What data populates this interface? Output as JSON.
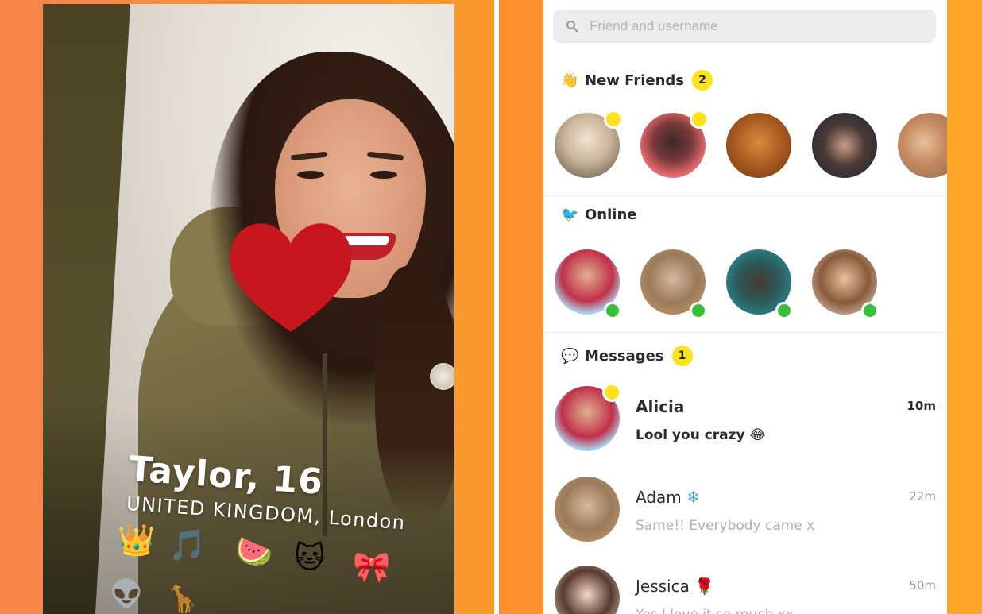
{
  "left_panel": {
    "profile": {
      "name_age": "Taylor, 16",
      "location": "UNITED KINGDOM, London"
    },
    "emoji_interests": [
      "👑",
      "🎵",
      "🍉",
      "🐱",
      "🎀"
    ],
    "emoji_more": [
      "👽",
      "🦒"
    ],
    "background_color": "#f7864a"
  },
  "right_panel": {
    "search": {
      "placeholder": "Friend and username",
      "value": ""
    },
    "new_friends": {
      "icon": "👋",
      "title": "New Friends",
      "count": "2",
      "avatars": [
        {
          "name": "new-friend-1",
          "new": true
        },
        {
          "name": "new-friend-2",
          "new": true
        },
        {
          "name": "new-friend-3",
          "new": false
        },
        {
          "name": "new-friend-4",
          "new": false
        },
        {
          "name": "new-friend-5",
          "new": false
        }
      ]
    },
    "online": {
      "icon": "🐦",
      "title": "Online",
      "avatars": [
        {
          "name": "online-1"
        },
        {
          "name": "online-2"
        },
        {
          "name": "online-3"
        },
        {
          "name": "online-4"
        }
      ]
    },
    "messages": {
      "icon": "💬",
      "title": "Messages",
      "count": "1",
      "items": [
        {
          "name": "Alicia",
          "badge": "",
          "time": "10m",
          "text": "Lool you crazy 😂",
          "unread": true
        },
        {
          "name": "Adam",
          "badge": "❄",
          "time": "22m",
          "text": "Same!! Everybody came x",
          "unread": false
        },
        {
          "name": "Jessica",
          "badge": "🌹",
          "time": "50m",
          "text": "Yes I love it so much xx",
          "unread": false
        }
      ]
    },
    "colors": {
      "accent_yellow": "#ffe21a",
      "online_green": "#34c238",
      "background_orange": "#fb9a2a"
    }
  }
}
